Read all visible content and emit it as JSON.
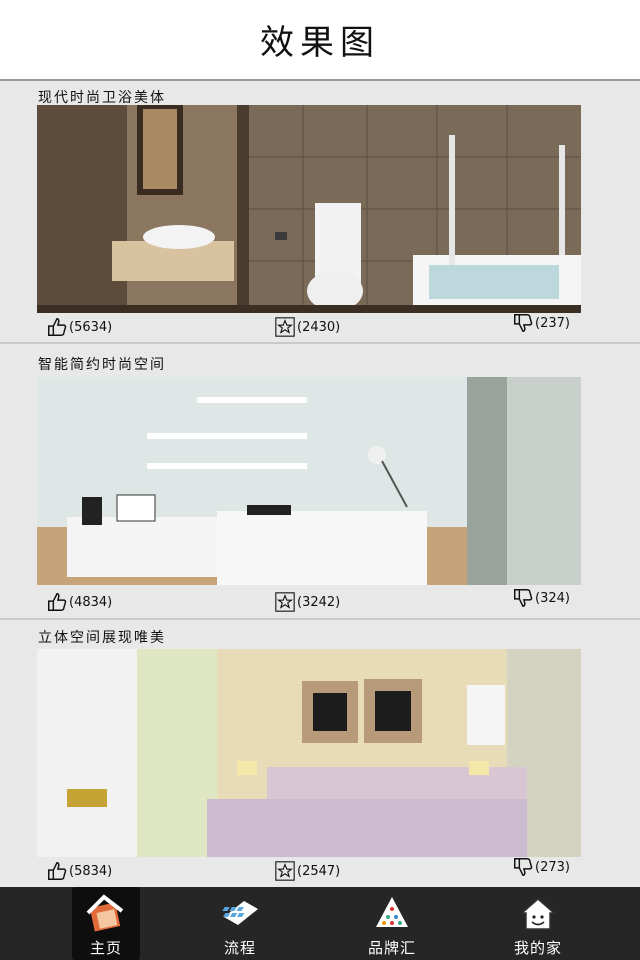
{
  "header": {
    "title": "效果图"
  },
  "cards": [
    {
      "title": "现代时尚卫浴美体",
      "likes": "(5634)",
      "favorites": "(2430)",
      "dislikes": "(237)"
    },
    {
      "title": "智能简约时尚空间",
      "likes": "(4834)",
      "favorites": "(3242)",
      "dislikes": "(324)"
    },
    {
      "title": "立体空间展现唯美",
      "likes": "(5834)",
      "favorites": "(2547)",
      "dislikes": "(273)"
    }
  ],
  "tabbar": {
    "items": [
      {
        "label": "主页",
        "icon": "home-icon",
        "active": true
      },
      {
        "label": "流程",
        "icon": "process-icon",
        "active": false
      },
      {
        "label": "品牌汇",
        "icon": "brand-icon",
        "active": false
      },
      {
        "label": "我的家",
        "icon": "my-home-icon",
        "active": false
      }
    ]
  },
  "icons": {
    "like": "thumbs-up-icon",
    "favorite": "star-icon",
    "dislike": "thumbs-down-icon"
  }
}
